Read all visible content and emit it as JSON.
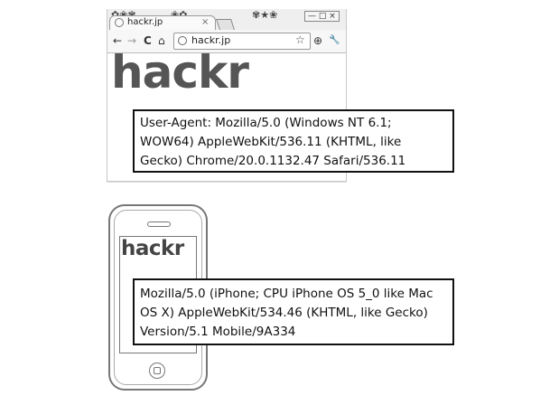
{
  "desktop": {
    "tab": {
      "title": "hackr.jp",
      "close_glyph": "×",
      "favicon_icon": "globe-icon"
    },
    "toolbar": {
      "back_glyph": "←",
      "forward_glyph": "→",
      "reload_glyph": "C",
      "home_glyph": "⌂",
      "url": "hackr.jp",
      "star_glyph": "☆",
      "wrench_glyph": "🔧",
      "page_glyph": "⊕"
    },
    "window_controls": "— □ ×",
    "logo": "hackr",
    "user_agent": "User-Agent: Mozilla/5.0 (Windows NT 6.1; WOW64) AppleWebKit/536.11 (KHTML, like Gecko) Chrome/20.0.1132.47 Safari/536.11"
  },
  "mobile": {
    "logo": "hackr",
    "user_agent": "Mozilla/5.0 (iPhone; CPU iPhone OS 5_0 like Mac OS X) AppleWebKit/534.46 (KHTML, like Gecko) Version/5.1 Mobile/9A334"
  },
  "colors": {
    "border": "#111111",
    "logo": "#555555"
  }
}
